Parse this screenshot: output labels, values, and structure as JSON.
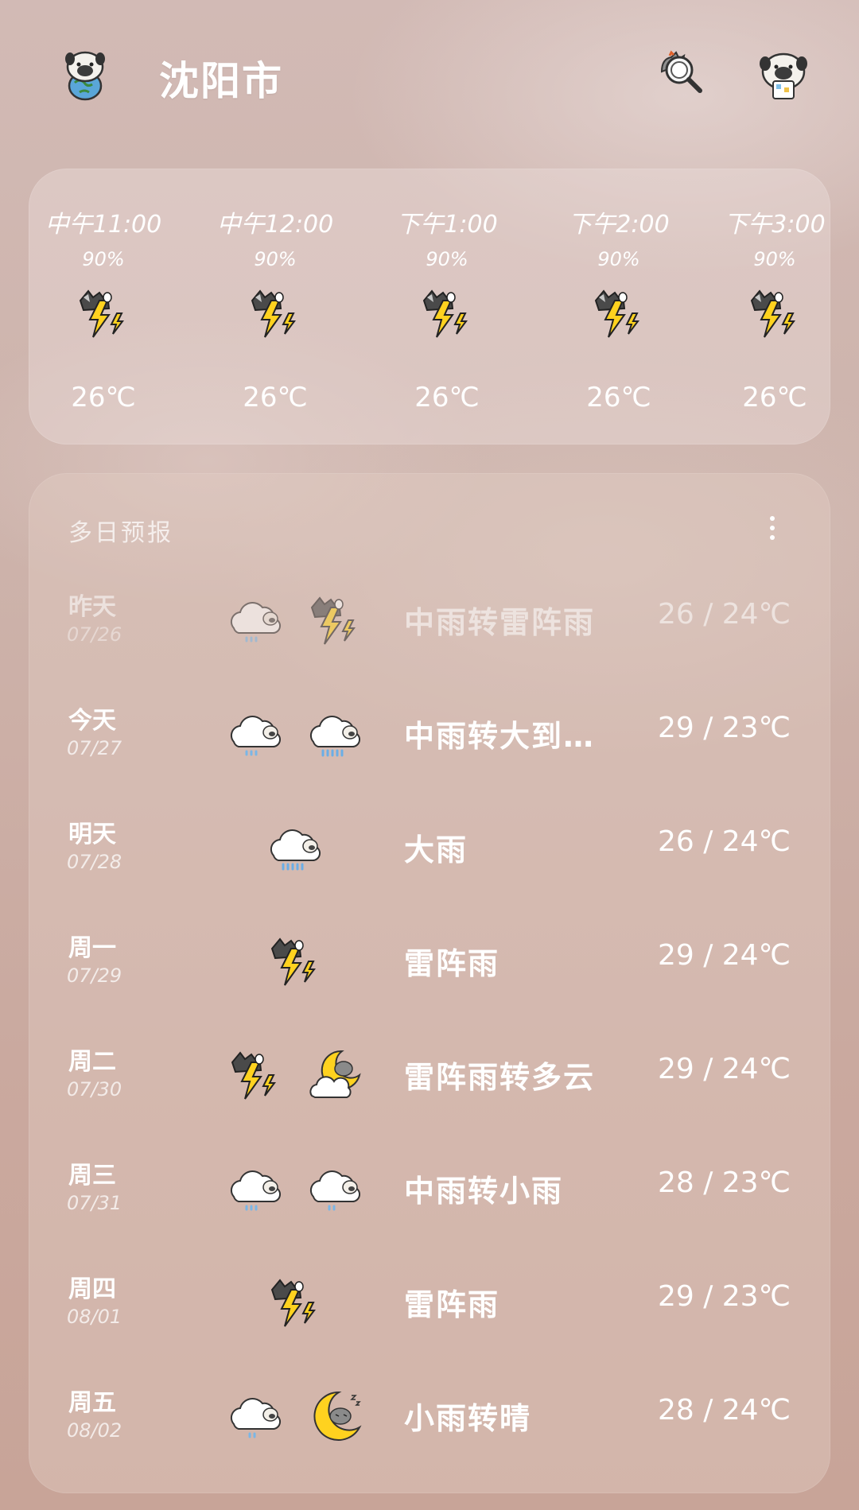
{
  "header": {
    "city": "沈阳市",
    "left_avatar_icon": "pug-holding-globe-icon",
    "search_icon": "cat-magnifier-search-icon",
    "right_avatar_icon": "pug-reading-icon"
  },
  "hourly": [
    {
      "time": "中午11:00",
      "precip": "90%",
      "icon": "thunderstorm-icon",
      "temp": "26℃"
    },
    {
      "time": "中午12:00",
      "precip": "90%",
      "icon": "thunderstorm-icon",
      "temp": "26℃"
    },
    {
      "time": "下午1:00",
      "precip": "90%",
      "icon": "thunderstorm-icon",
      "temp": "26℃"
    },
    {
      "time": "下午2:00",
      "precip": "90%",
      "icon": "thunderstorm-icon",
      "temp": "26℃"
    },
    {
      "time": "下午3:00",
      "precip": "90%",
      "icon": "thunderstorm-icon",
      "temp": "26℃"
    }
  ],
  "daily_title": "多日预报",
  "daily": [
    {
      "day": "昨天",
      "date": "07/26",
      "icons": [
        "moderate-rain-icon",
        "thunderstorm-icon"
      ],
      "desc": "中雨转雷阵雨",
      "temp": "26 / 24℃",
      "faded": true
    },
    {
      "day": "今天",
      "date": "07/27",
      "icons": [
        "moderate-rain-icon",
        "heavy-rain-icon"
      ],
      "desc": "中雨转大到…",
      "temp": "29 / 23℃",
      "faded": false
    },
    {
      "day": "明天",
      "date": "07/28",
      "icons": [
        "heavy-rain-icon"
      ],
      "desc": "大雨",
      "temp": "26 / 24℃",
      "faded": false
    },
    {
      "day": "周一",
      "date": "07/29",
      "icons": [
        "thunderstorm-icon"
      ],
      "desc": "雷阵雨",
      "temp": "29 / 24℃",
      "faded": false
    },
    {
      "day": "周二",
      "date": "07/30",
      "icons": [
        "thunderstorm-icon",
        "cloudy-night-icon"
      ],
      "desc": "雷阵雨转多云",
      "temp": "29 / 24℃",
      "faded": false
    },
    {
      "day": "周三",
      "date": "07/31",
      "icons": [
        "moderate-rain-icon",
        "light-rain-icon"
      ],
      "desc": "中雨转小雨",
      "temp": "28 / 23℃",
      "faded": false
    },
    {
      "day": "周四",
      "date": "08/01",
      "icons": [
        "thunderstorm-icon"
      ],
      "desc": "雷阵雨",
      "temp": "29 / 23℃",
      "faded": false
    },
    {
      "day": "周五",
      "date": "08/02",
      "icons": [
        "light-rain-icon",
        "clear-night-icon"
      ],
      "desc": "小雨转晴",
      "temp": "28 / 24℃",
      "faded": false
    }
  ]
}
